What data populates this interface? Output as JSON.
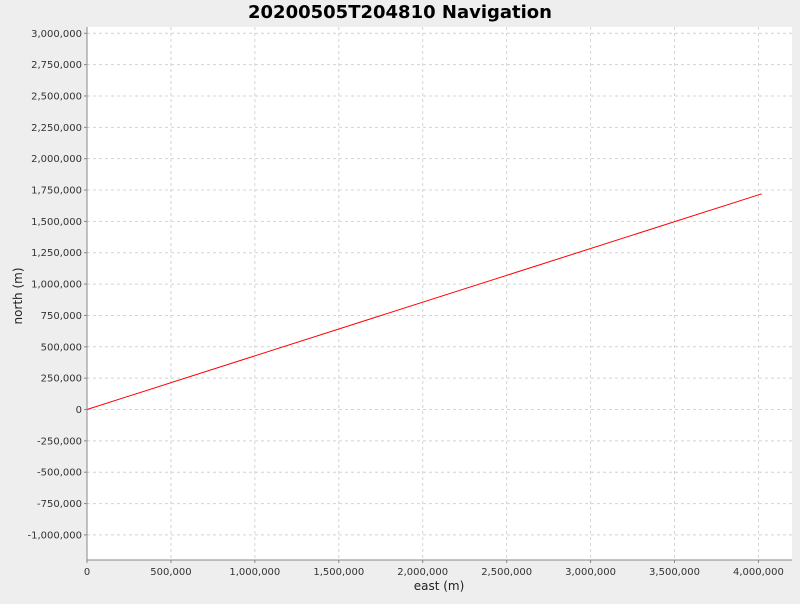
{
  "chart_data": {
    "type": "line",
    "title": "20200505T204810 Navigation",
    "xlabel": "east (m)",
    "ylabel": "north (m)",
    "xlim": [
      0,
      4200000
    ],
    "ylim": [
      -1200000,
      3050000
    ],
    "x_ticks": [
      0,
      500000,
      1000000,
      1500000,
      2000000,
      2500000,
      3000000,
      3500000,
      4000000
    ],
    "x_tick_labels": [
      "0",
      "500,000",
      "1,000,000",
      "1,500,000",
      "2,000,000",
      "2,500,000",
      "3,000,000",
      "3,500,000",
      "4,000,000"
    ],
    "y_ticks": [
      3000000,
      2750000,
      2500000,
      2250000,
      2000000,
      1750000,
      1500000,
      1250000,
      1000000,
      750000,
      500000,
      250000,
      0,
      -250000,
      -500000,
      -750000,
      -1000000
    ],
    "y_tick_labels": [
      "3,000,000",
      "2,750,000",
      "2,500,000",
      "2,250,000",
      "2,000,000",
      "1,750,000",
      "1,500,000",
      "1,250,000",
      "1,000,000",
      "750,000",
      "500,000",
      "250,000",
      "0",
      "-250,000",
      "-500,000",
      "-750,000",
      "-1,000,000"
    ],
    "grid": true,
    "series": [
      {
        "color": "#ff0000",
        "x": [
          0,
          4020000
        ],
        "y": [
          0,
          1720000
        ]
      }
    ]
  },
  "colors": {
    "background": "#eeeeee",
    "plot_background": "#ffffff",
    "grid": "#d4d4d4",
    "axis": "#888888",
    "series": "#ff0000"
  }
}
